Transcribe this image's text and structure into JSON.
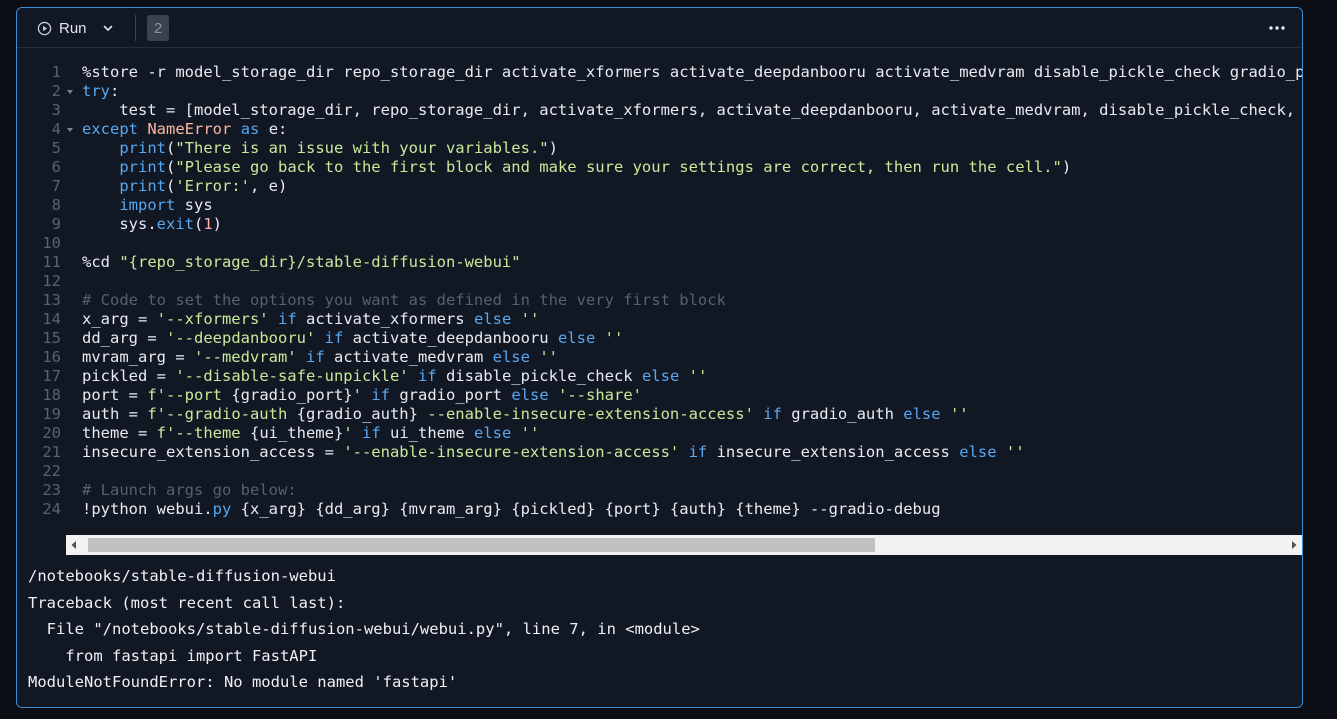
{
  "toolbar": {
    "run_label": "Run",
    "execution_count": "2"
  },
  "code_lines": [
    [
      {
        "t": "%store -r model_storage_dir repo_storage_dir activate_xformers activate_deepdanbooru activate_medvram disable_pickle_check gradio_port gradio_auth ui_theme insecure_extension_access"
      }
    ],
    [
      {
        "t": "try",
        "c": "k"
      },
      {
        "t": ":"
      }
    ],
    [
      {
        "t": "    test = [model_storage_dir, repo_storage_dir, activate_xformers, activate_deepdanbooru, activate_medvram, disable_pickle_check, gradio_port, gradio_auth, ui_theme, insecure_extension_access]"
      }
    ],
    [
      {
        "t": "except",
        "c": "k"
      },
      {
        "t": " "
      },
      {
        "t": "NameError",
        "c": "n"
      },
      {
        "t": " "
      },
      {
        "t": "as",
        "c": "k"
      },
      {
        "t": " e:"
      }
    ],
    [
      {
        "t": "    "
      },
      {
        "t": "print",
        "c": "f"
      },
      {
        "t": "("
      },
      {
        "t": "\"There is an issue with your variables.\"",
        "c": "s"
      },
      {
        "t": ")"
      }
    ],
    [
      {
        "t": "    "
      },
      {
        "t": "print",
        "c": "f"
      },
      {
        "t": "("
      },
      {
        "t": "\"Please go back to the first block and make sure your settings are correct, then run the cell.\"",
        "c": "s"
      },
      {
        "t": ")"
      }
    ],
    [
      {
        "t": "    "
      },
      {
        "t": "print",
        "c": "f"
      },
      {
        "t": "("
      },
      {
        "t": "'Error:'",
        "c": "s"
      },
      {
        "t": ", e)"
      }
    ],
    [
      {
        "t": "    "
      },
      {
        "t": "import",
        "c": "k"
      },
      {
        "t": " sys"
      }
    ],
    [
      {
        "t": "    sys."
      },
      {
        "t": "exit",
        "c": "f"
      },
      {
        "t": "("
      },
      {
        "t": "1",
        "c": "n"
      },
      {
        "t": ")"
      }
    ],
    [],
    [
      {
        "t": "%cd "
      },
      {
        "t": "\"{repo_storage_dir}/stable-diffusion-webui\"",
        "c": "s"
      }
    ],
    [],
    [
      {
        "t": "# Code to set the options you want as defined in the very first block",
        "c": "c"
      }
    ],
    [
      {
        "t": "x_arg = "
      },
      {
        "t": "'--xformers'",
        "c": "s"
      },
      {
        "t": " "
      },
      {
        "t": "if",
        "c": "k"
      },
      {
        "t": " activate_xformers "
      },
      {
        "t": "else",
        "c": "k"
      },
      {
        "t": " "
      },
      {
        "t": "''",
        "c": "s"
      }
    ],
    [
      {
        "t": "dd_arg = "
      },
      {
        "t": "'--deepdanbooru'",
        "c": "s"
      },
      {
        "t": " "
      },
      {
        "t": "if",
        "c": "k"
      },
      {
        "t": " activate_deepdanbooru "
      },
      {
        "t": "else",
        "c": "k"
      },
      {
        "t": " "
      },
      {
        "t": "''",
        "c": "s"
      }
    ],
    [
      {
        "t": "mvram_arg = "
      },
      {
        "t": "'--medvram'",
        "c": "s"
      },
      {
        "t": " "
      },
      {
        "t": "if",
        "c": "k"
      },
      {
        "t": " activate_medvram "
      },
      {
        "t": "else",
        "c": "k"
      },
      {
        "t": " "
      },
      {
        "t": "''",
        "c": "s"
      }
    ],
    [
      {
        "t": "pickled = "
      },
      {
        "t": "'--disable-safe-unpickle'",
        "c": "s"
      },
      {
        "t": " "
      },
      {
        "t": "if",
        "c": "k"
      },
      {
        "t": " disable_pickle_check "
      },
      {
        "t": "else",
        "c": "k"
      },
      {
        "t": " "
      },
      {
        "t": "''",
        "c": "s"
      }
    ],
    [
      {
        "t": "port = "
      },
      {
        "t": "f'--port ",
        "c": "s"
      },
      {
        "t": "{gradio_port}"
      },
      {
        "t": "'",
        "c": "s"
      },
      {
        "t": " "
      },
      {
        "t": "if",
        "c": "k"
      },
      {
        "t": " gradio_port "
      },
      {
        "t": "else",
        "c": "k"
      },
      {
        "t": " "
      },
      {
        "t": "'--share'",
        "c": "s"
      }
    ],
    [
      {
        "t": "auth = "
      },
      {
        "t": "f'--gradio-auth ",
        "c": "s"
      },
      {
        "t": "{gradio_auth}"
      },
      {
        "t": " --enable-insecure-extension-access'",
        "c": "s"
      },
      {
        "t": " "
      },
      {
        "t": "if",
        "c": "k"
      },
      {
        "t": " gradio_auth "
      },
      {
        "t": "else",
        "c": "k"
      },
      {
        "t": " "
      },
      {
        "t": "''",
        "c": "s"
      }
    ],
    [
      {
        "t": "theme = "
      },
      {
        "t": "f'--theme ",
        "c": "s"
      },
      {
        "t": "{ui_theme}"
      },
      {
        "t": "'",
        "c": "s"
      },
      {
        "t": " "
      },
      {
        "t": "if",
        "c": "k"
      },
      {
        "t": " ui_theme "
      },
      {
        "t": "else",
        "c": "k"
      },
      {
        "t": " "
      },
      {
        "t": "''",
        "c": "s"
      }
    ],
    [
      {
        "t": "insecure_extension_access = "
      },
      {
        "t": "'--enable-insecure-extension-access'",
        "c": "s"
      },
      {
        "t": " "
      },
      {
        "t": "if",
        "c": "k"
      },
      {
        "t": " insecure_extension_access "
      },
      {
        "t": "else",
        "c": "k"
      },
      {
        "t": " "
      },
      {
        "t": "''",
        "c": "s"
      }
    ],
    [],
    [
      {
        "t": "# Launch args go below:",
        "c": "c"
      }
    ],
    [
      {
        "t": "!python webui."
      },
      {
        "t": "py",
        "c": "f"
      },
      {
        "t": " {x_arg} {dd_arg} {mvram_arg} {pickled} {port} {auth} {theme} --gradio-debug"
      }
    ]
  ],
  "fold_lines": [
    2,
    4
  ],
  "output_lines": [
    "/notebooks/stable-diffusion-webui",
    "Traceback (most recent call last):",
    "  File \"/notebooks/stable-diffusion-webui/webui.py\", line 7, in <module>",
    "    from fastapi import FastAPI",
    "ModuleNotFoundError: No module named 'fastapi'"
  ],
  "scrollbar": {
    "thumb_fraction": 0.66,
    "position": 0.0
  },
  "colors": {
    "accent_border": "#3a8fd6",
    "background": "#111723"
  }
}
